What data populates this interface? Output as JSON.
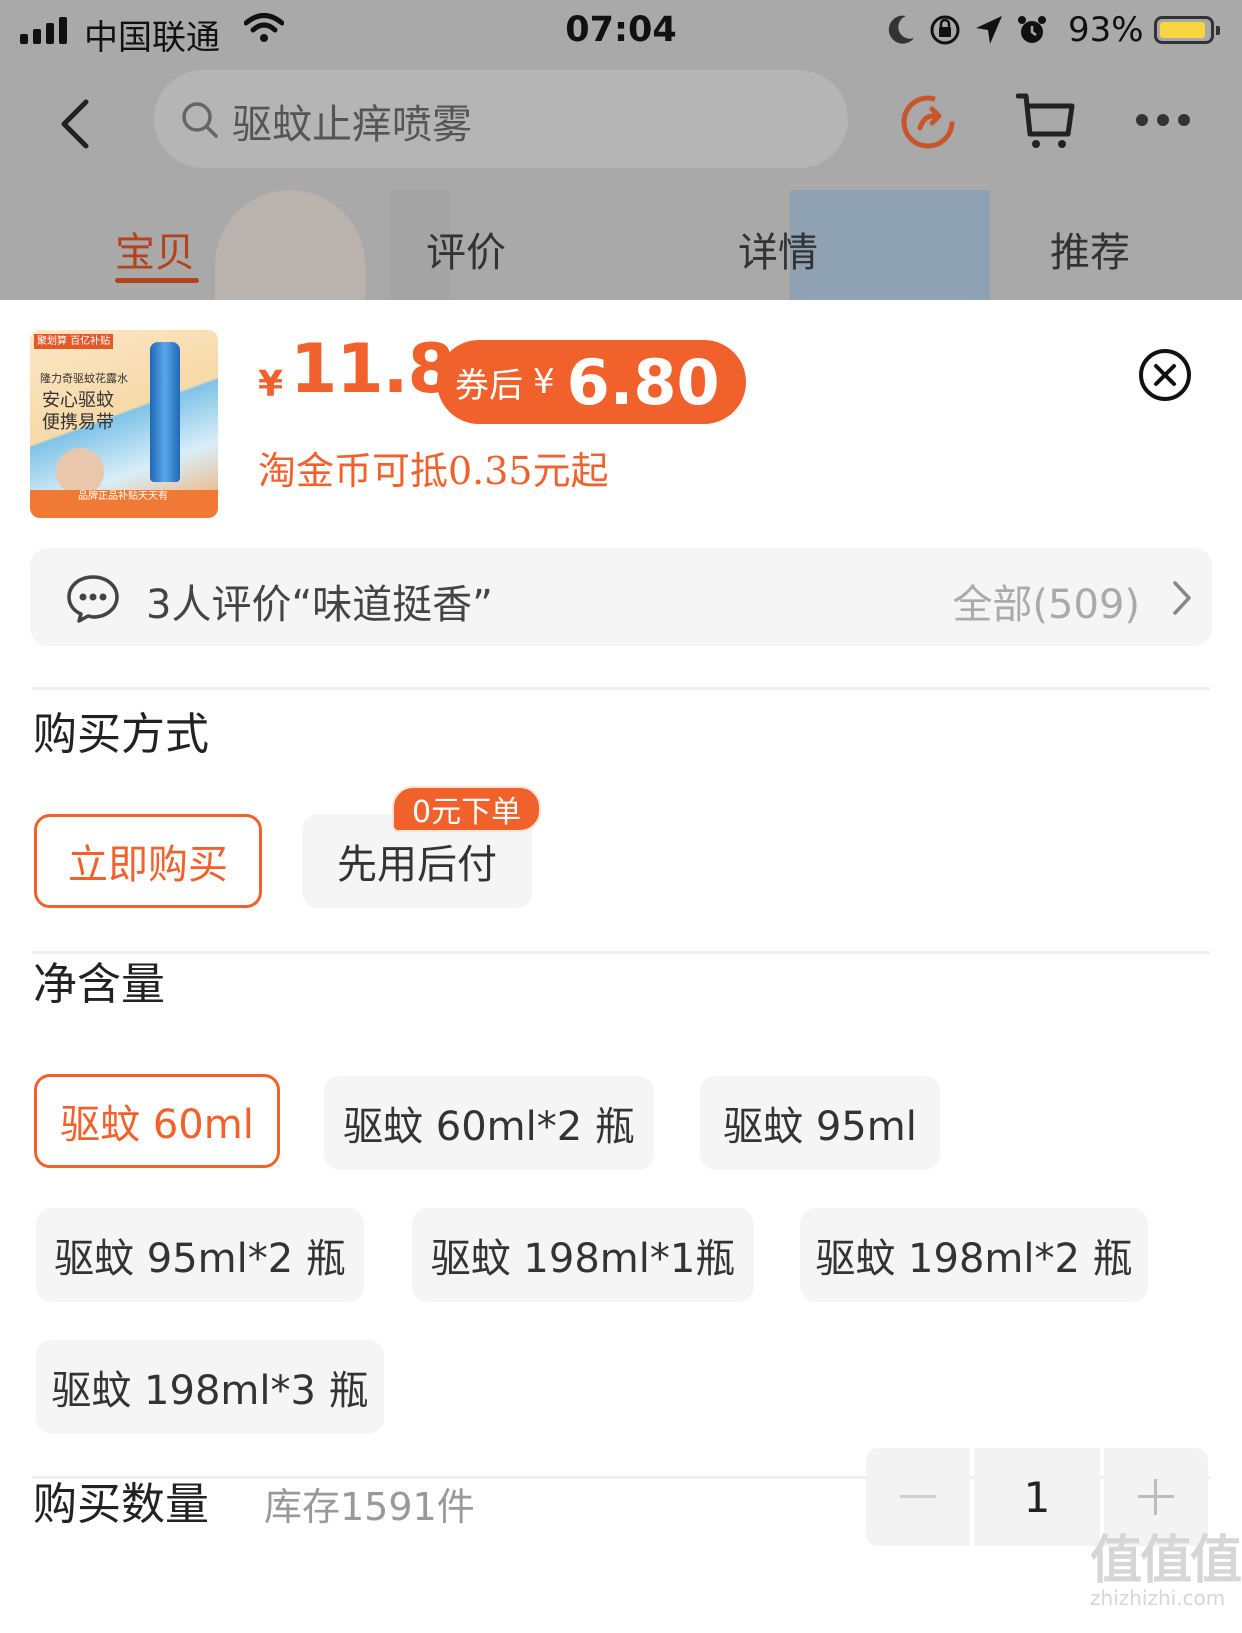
{
  "status_bar": {
    "carrier": "中国联通",
    "time": "07:04",
    "battery": "93%"
  },
  "nav": {
    "search_text": "驱蚊止痒喷雾"
  },
  "tabs": [
    {
      "label": "宝贝",
      "active": true
    },
    {
      "label": "评价",
      "active": false
    },
    {
      "label": "详情",
      "active": false
    },
    {
      "label": "推荐",
      "active": false
    }
  ],
  "product": {
    "thumb": {
      "badge": "聚划算 百亿补贴",
      "brand": "隆力奇驱蚊花露水",
      "slogan": "安心驱蚊 便携易带",
      "footer": "品牌正品补贴天天有"
    },
    "currency": "¥",
    "price": "11.8",
    "coupon": {
      "label": "券后",
      "currency": "¥",
      "value": "6.80"
    },
    "coins_text": "淘金币可抵0.35元起"
  },
  "review_bar": {
    "text": "3人评价“味道挺香”",
    "count_text": "全部(509)"
  },
  "purchase_method": {
    "title": "购买方式",
    "options": [
      {
        "label": "立即购买",
        "selected": true
      },
      {
        "label": "先用后付",
        "selected": false
      }
    ],
    "tag": "0元下单"
  },
  "net_content": {
    "title": "净含量",
    "options": [
      {
        "label": "驱蚊 60ml",
        "selected": true
      },
      {
        "label": "驱蚊 60ml*2 瓶",
        "selected": false
      },
      {
        "label": "驱蚊 95ml",
        "selected": false
      },
      {
        "label": "驱蚊 95ml*2 瓶",
        "selected": false
      },
      {
        "label": "驱蚊 198ml*1瓶",
        "selected": false
      },
      {
        "label": "驱蚊 198ml*2 瓶",
        "selected": false
      },
      {
        "label": "驱蚊 198ml*3 瓶",
        "selected": false
      }
    ]
  },
  "quantity": {
    "title": "购买数量",
    "stock_text": "库存1591件",
    "value": "1"
  },
  "watermark": {
    "cn": "值值值",
    "en": "zhizhizhi.com"
  },
  "colors": {
    "accent": "#f0612c",
    "tab_active": "#b3431c",
    "chip_bg": "#f5f5f5",
    "backdrop": "#a9a9a9"
  }
}
